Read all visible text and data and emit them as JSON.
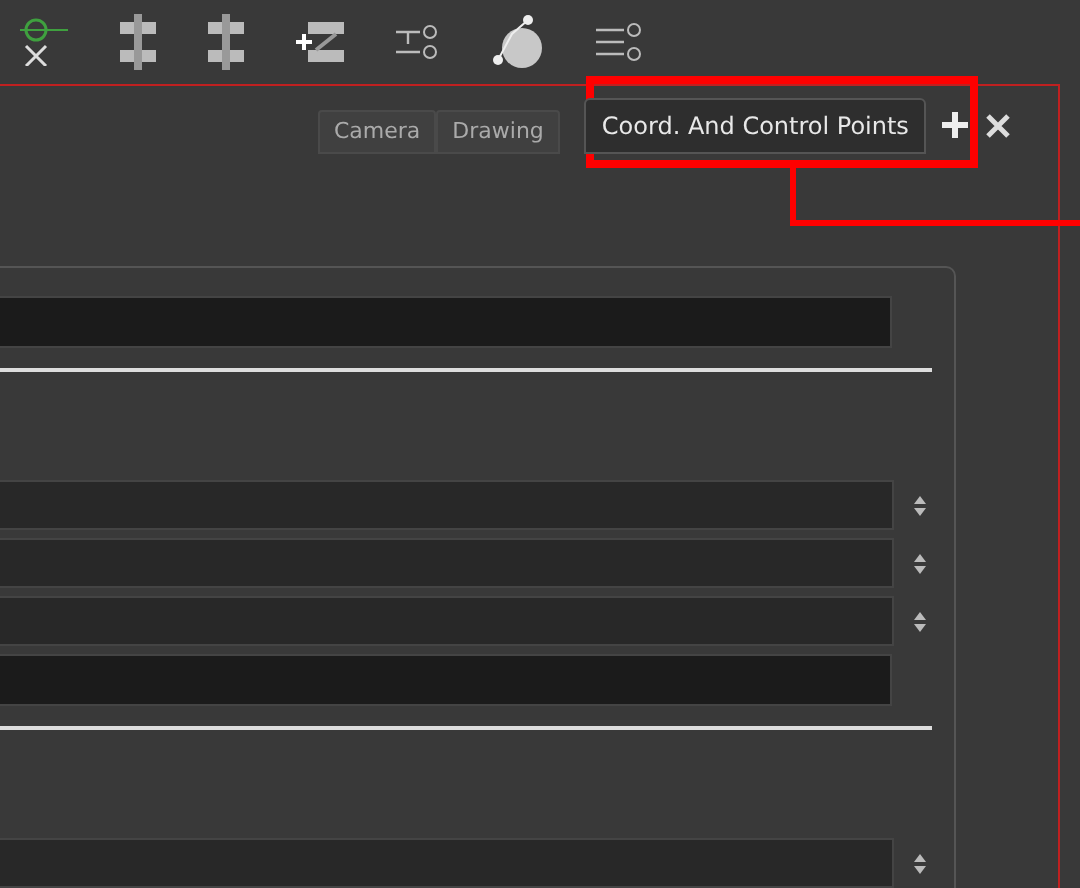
{
  "tabs": [
    {
      "label": "Camera",
      "selected": false
    },
    {
      "label": "Drawing",
      "selected": false
    },
    {
      "label": "Coord. And Control Points",
      "selected": true
    }
  ],
  "form_rows": [
    {
      "kind": "text"
    },
    {
      "kind": "rule"
    },
    {
      "kind": "gap"
    },
    {
      "kind": "spin"
    },
    {
      "kind": "spin"
    },
    {
      "kind": "spin"
    },
    {
      "kind": "text"
    },
    {
      "kind": "rule"
    },
    {
      "kind": "gap"
    },
    {
      "kind": "spin"
    }
  ]
}
